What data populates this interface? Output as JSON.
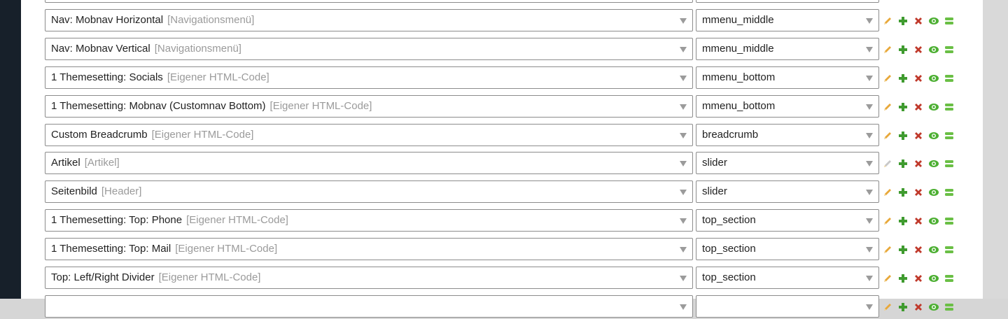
{
  "rows": [
    {
      "module": "",
      "type": "",
      "slot": "",
      "edit_enabled": true
    },
    {
      "module": "Nav: Mobnav Horizontal",
      "type": "[Navigationsmenü]",
      "slot": "mmenu_middle",
      "edit_enabled": true
    },
    {
      "module": "Nav: Mobnav Vertical",
      "type": "[Navigationsmenü]",
      "slot": "mmenu_middle",
      "edit_enabled": true
    },
    {
      "module": "1 Themesetting: Socials",
      "type": "[Eigener HTML-Code]",
      "slot": "mmenu_bottom",
      "edit_enabled": true
    },
    {
      "module": "1 Themesetting: Mobnav (Customnav Bottom)",
      "type": "[Eigener HTML-Code]",
      "slot": "mmenu_bottom",
      "edit_enabled": true
    },
    {
      "module": "Custom Breadcrumb",
      "type": "[Eigener HTML-Code]",
      "slot": "breadcrumb",
      "edit_enabled": true
    },
    {
      "module": "Artikel",
      "type": "[Artikel]",
      "slot": "slider",
      "edit_enabled": false
    },
    {
      "module": "Seitenbild",
      "type": "[Header]",
      "slot": "slider",
      "edit_enabled": true
    },
    {
      "module": "1 Themesetting: Top: Phone",
      "type": "[Eigener HTML-Code]",
      "slot": "top_section",
      "edit_enabled": true
    },
    {
      "module": "1 Themesetting: Top: Mail",
      "type": "[Eigener HTML-Code]",
      "slot": "top_section",
      "edit_enabled": true
    },
    {
      "module": "Top: Left/Right Divider",
      "type": "[Eigener HTML-Code]",
      "slot": "top_section",
      "edit_enabled": true
    },
    {
      "module": "",
      "type": "",
      "slot": "",
      "edit_enabled": true
    }
  ],
  "icons": {
    "edit": "pencil-icon",
    "add": "plus-icon",
    "delete": "cross-icon",
    "toggle": "eye-icon",
    "move": "drag-handle-icon"
  },
  "colors": {
    "edit": "#e8a83a",
    "edit_disabled": "#c8c8c8",
    "add": "#3f9b2f",
    "delete": "#c0392b",
    "toggle": "#4caf32",
    "move": "#6abf45"
  }
}
